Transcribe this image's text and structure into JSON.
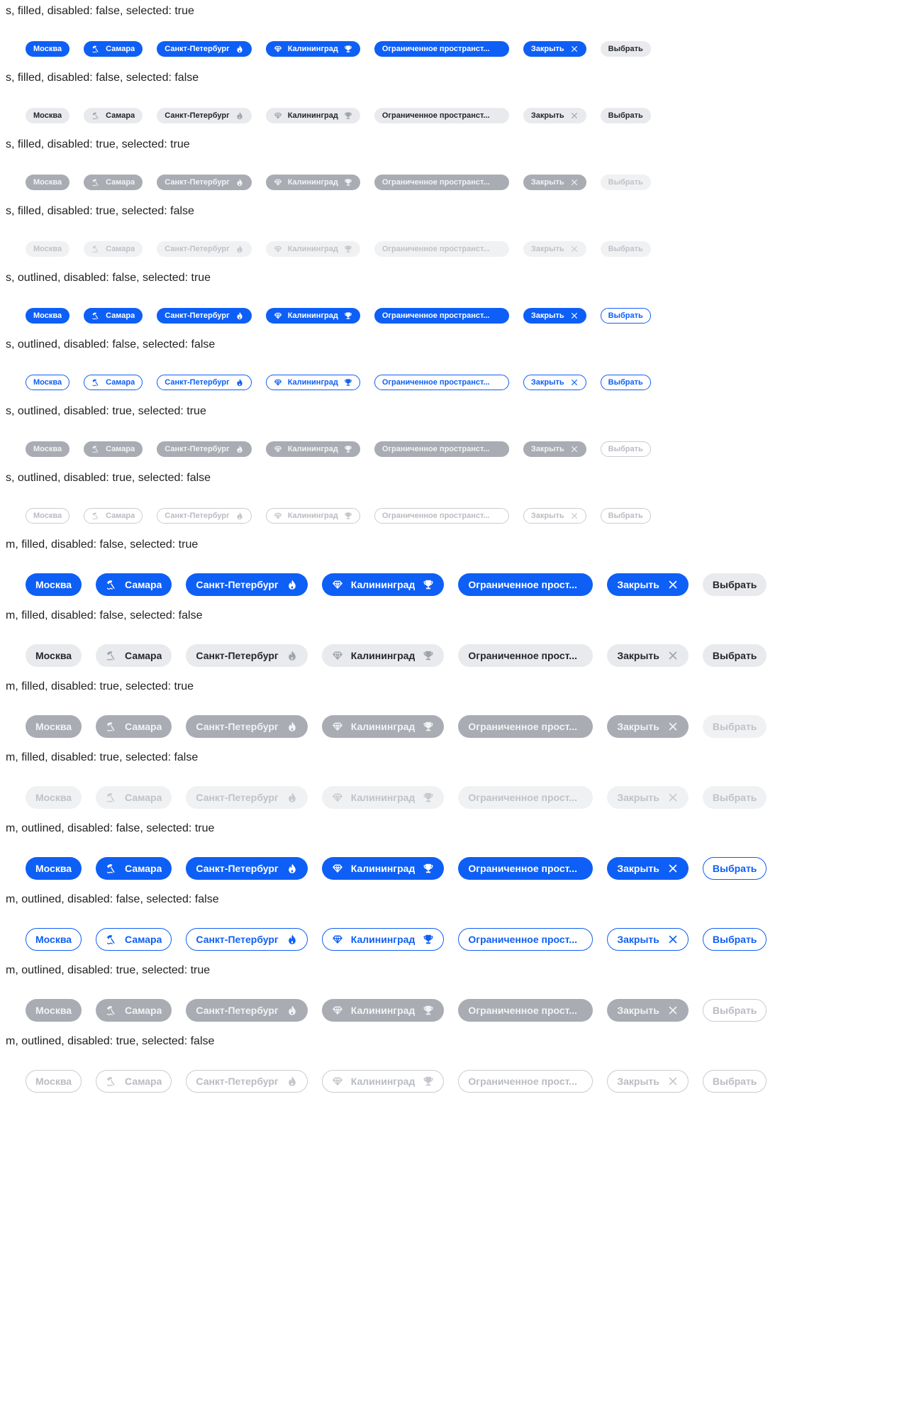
{
  "chip_labels": {
    "moscow": "Москва",
    "samara": "Самара",
    "spb": "Санкт-Петербург",
    "kaliningrad": "Калининград",
    "limited_s": "Ограниченное пространст...",
    "limited_m": "Ограниченное прост...",
    "close": "Закрыть",
    "pick": "Выбрать"
  },
  "icons": {
    "samara": "beach-umbrella-icon",
    "spb": "fire-icon",
    "kaliningrad_lead": "diamond-icon",
    "kaliningrad_trail": "trophy-icon",
    "close": "close-icon"
  },
  "colors": {
    "selected_blue": "#0e5ff5",
    "filled_gray": "#e9eaed",
    "disabled_selected_gray": "#a9acb3",
    "disabled_faint": "#f0f1f3",
    "outline_disabled": "#c9ccd1"
  },
  "sections": [
    {
      "label": "s, filled, disabled: false, selected: true",
      "size": "s",
      "state": "sel",
      "pick": "gray"
    },
    {
      "label": "s, filled, disabled: false, selected: false",
      "size": "s",
      "state": "fill",
      "pick": "gray"
    },
    {
      "label": "s, filled, disabled: true, selected: true",
      "size": "s",
      "state": "dsel",
      "pick": "faint"
    },
    {
      "label": "s, filled, disabled: true, selected: false",
      "size": "s",
      "state": "dfill",
      "pick": "faint"
    },
    {
      "label": "s, outlined, disabled: false, selected: true",
      "size": "s",
      "state": "sel",
      "pick": "blueoutline"
    },
    {
      "label": "s, outlined, disabled: false, selected: false",
      "size": "s",
      "state": "out",
      "pick": "blueoutline"
    },
    {
      "label": "s, outlined, disabled: true, selected: true",
      "size": "s",
      "state": "dsel",
      "pick": "grayoutline"
    },
    {
      "label": "s, outlined, disabled: true, selected: false",
      "size": "s",
      "state": "dout",
      "pick": "grayoutline"
    },
    {
      "label": "m, filled, disabled: false, selected: true",
      "size": "m",
      "state": "sel",
      "pick": "gray"
    },
    {
      "label": "m, filled, disabled: false, selected: false",
      "size": "m",
      "state": "fill",
      "pick": "gray"
    },
    {
      "label": "m, filled, disabled: true, selected: true",
      "size": "m",
      "state": "dsel",
      "pick": "faint"
    },
    {
      "label": "m, filled, disabled: true, selected: false",
      "size": "m",
      "state": "dfill",
      "pick": "faint"
    },
    {
      "label": "m, outlined, disabled: false, selected: true",
      "size": "m",
      "state": "sel",
      "pick": "blueoutline"
    },
    {
      "label": "m, outlined, disabled: false, selected: false",
      "size": "m",
      "state": "out",
      "pick": "blueoutline"
    },
    {
      "label": "m, outlined, disabled: true, selected: true",
      "size": "m",
      "state": "dsel",
      "pick": "grayoutline"
    },
    {
      "label": "m, outlined, disabled: true, selected: false",
      "size": "m",
      "state": "dout",
      "pick": "grayoutline"
    }
  ]
}
